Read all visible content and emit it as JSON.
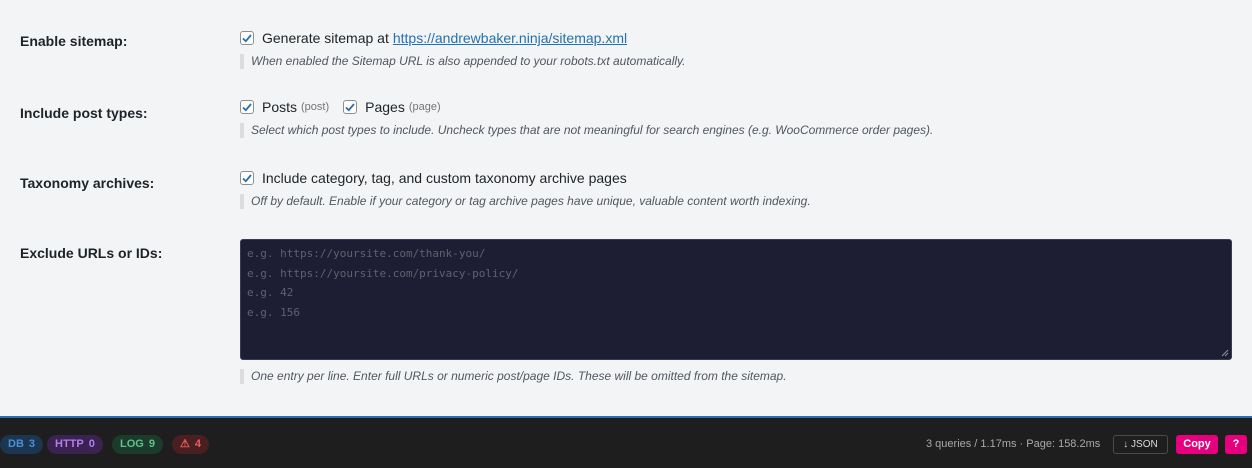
{
  "settings": {
    "sitemap": {
      "label": "Enable sitemap:",
      "checkbox_text": "Generate sitemap at",
      "url": "https://andrewbaker.ninja/sitemap.xml",
      "checked": true,
      "help": "When enabled the Sitemap URL is also appended to your robots.txt automatically."
    },
    "post_types": {
      "label": "Include post types:",
      "items": [
        {
          "label": "Posts",
          "slug": "(post)",
          "checked": true
        },
        {
          "label": "Pages",
          "slug": "(page)",
          "checked": true
        }
      ],
      "help": "Select which post types to include. Uncheck types that are not meaningful for search engines (e.g. WooCommerce order pages)."
    },
    "taxonomy": {
      "label": "Taxonomy archives:",
      "checkbox_text": "Include category, tag, and custom taxonomy archive pages",
      "checked": true,
      "help": "Off by default. Enable if your category or tag archive pages have unique, valuable content worth indexing."
    },
    "exclude": {
      "label": "Exclude URLs or IDs:",
      "placeholder_lines": [
        "e.g. https://yoursite.com/thank-you/",
        "e.g. https://yoursite.com/privacy-policy/",
        "e.g. 42",
        "e.g. 156"
      ],
      "help": "One entry per line. Enter full URLs or numeric post/page IDs. These will be omitted from the sitemap."
    }
  },
  "toolbar": {
    "pills": [
      {
        "label": "DB",
        "count": "3",
        "color": "#4a90d9",
        "bg": "#1c3550"
      },
      {
        "label": "HTTP",
        "count": "0",
        "color": "#b57cf0",
        "bg": "#3a2350"
      },
      {
        "label": "LOG",
        "count": "9",
        "color": "#5cc38a",
        "bg": "#1d3b2c"
      },
      {
        "label": "⚠",
        "count": "4",
        "color": "#f05a5a",
        "bg": "#4a1f22"
      }
    ],
    "stats": "3 queries / 1.17ms · Page: 158.2ms",
    "json_label": "↓ JSON",
    "copy_label": "Copy",
    "help_label": "?"
  }
}
